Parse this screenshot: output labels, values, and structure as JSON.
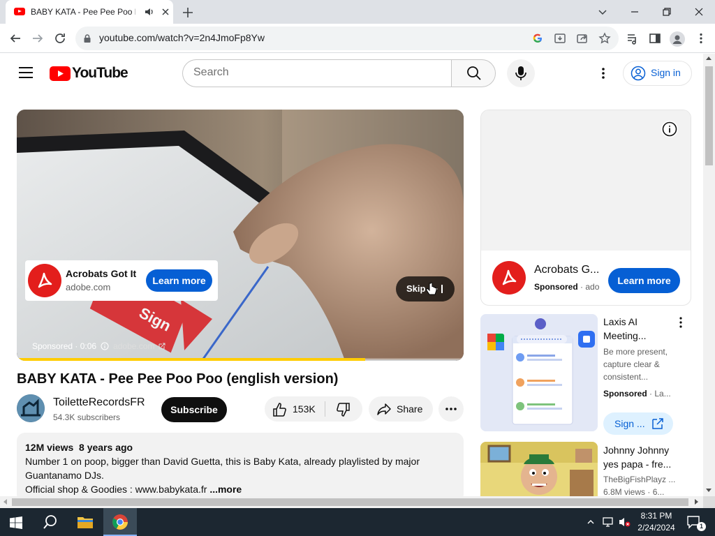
{
  "browser": {
    "tab_title": "BABY KATA - Pee Pee Poo Poo",
    "url": "youtube.com/watch?v=2n4JmoFp8Yw"
  },
  "youtube": {
    "logo_text": "YouTube",
    "search_placeholder": "Search",
    "sign_in": "Sign in"
  },
  "player": {
    "ad_title": "Acrobats Got It",
    "ad_domain": "adobe.com",
    "ad_learn_more": "Learn more",
    "skip_label": "Skip",
    "ad_status": "Sponsored · 0:06",
    "ad_status_domain": "adobe.com",
    "overlay_sign_text": "Sign",
    "progress": 0.78
  },
  "video": {
    "title": "BABY KATA - Pee Pee Poo Poo (english version)",
    "channel_name": "ToiletteRecordsFR",
    "subscribers": "54.3K subscribers",
    "subscribe_label": "Subscribe",
    "likes": "153K",
    "share_label": "Share",
    "views": "12M views",
    "age": "8 years ago",
    "description_line1": "Number 1 on poop, bigger than David Guetta, this is Baby Kata, already playlisted by major",
    "description_line2": "Guantanamo DJs.",
    "description_line3": "Official shop & Goodies : www.babykata.fr",
    "more_label": "...more"
  },
  "sidebar": {
    "ad_name": "Acrobats G...",
    "ad_sponsored": "Sponsored",
    "ad_domain_short": "ado",
    "ad_learn_more": "Learn more",
    "items": [
      {
        "title_line1": "Laxis AI",
        "title_line2": "Meeting...",
        "desc_line1": "Be more present,",
        "desc_line2": "capture clear &",
        "desc_line3": "consistent...",
        "sponsored": "Sponsored",
        "advertiser": "La...",
        "cta": "Sign ..."
      },
      {
        "title_line1": "Johnny Johnny",
        "title_line2": "yes papa - fre...",
        "channel": "TheBigFishPlayz ...",
        "views": "6.8M views",
        "age": "6..."
      }
    ]
  },
  "taskbar": {
    "time": "8:31 PM",
    "date": "2/24/2024",
    "notification_count": "1"
  }
}
